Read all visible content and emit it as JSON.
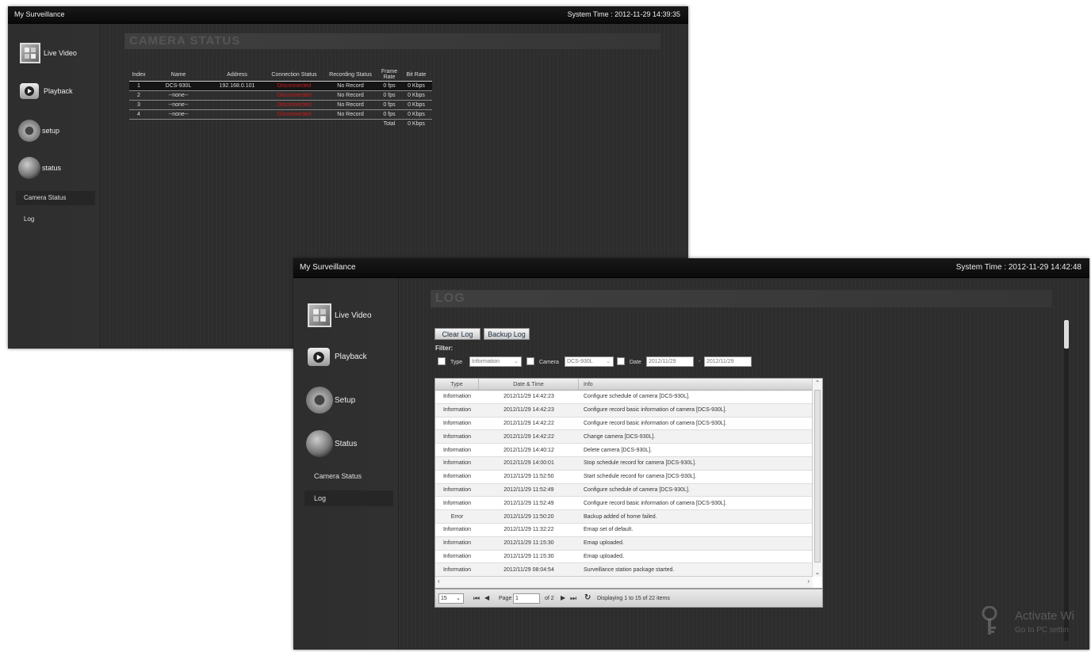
{
  "status_window": {
    "app_title": "My Surveillance",
    "system_time": "System Time : 2012-11-29 14:39:35",
    "nav": {
      "live_video": "Live Video",
      "playback": "Playback",
      "setup": "setup",
      "status": "status",
      "camera_status": "Camera Status",
      "log": "Log"
    },
    "section_title": "CAMERA STATUS",
    "table": {
      "headers": [
        "Index",
        "Name",
        "Address",
        "Connection Status",
        "Recording Status",
        "Frame Rate",
        "Bit Rate"
      ],
      "rows": [
        [
          "1",
          "DCS-930L",
          "192.168.0.101",
          "Disconnected",
          "No Record",
          "0 fps",
          "0 Kbps"
        ],
        [
          "2",
          "--none--",
          "",
          "Disconnected",
          "No Record",
          "0 fps",
          "0 Kbps"
        ],
        [
          "3",
          "--none--",
          "",
          "Disconnected",
          "No Record",
          "0 fps",
          "0 Kbps"
        ],
        [
          "4",
          "--none--",
          "",
          "Disconnected",
          "No Record",
          "0 fps",
          "0 Kbps"
        ]
      ],
      "total_label": "Total",
      "total_value": "0 Kbps"
    }
  },
  "log_window": {
    "app_title": "My Surveillance",
    "system_time": "System Time : 2012-11-29 14:42:48",
    "nav": {
      "live_video": "Live Video",
      "playback": "Playback",
      "setup": "Setup",
      "status": "Status",
      "camera_status": "Camera Status",
      "log": "Log"
    },
    "section_title": "LOG",
    "clear_log": "Clear Log",
    "backup_log": "Backup Log",
    "filter_label": "Filter:",
    "type_label": "Type",
    "type_value": "Information",
    "camera_label": "Camera",
    "camera_value": "DCS-930L",
    "date_label": "Date",
    "date_from": "2012/11/29",
    "date_sep": "-",
    "date_to": "2012/11/29",
    "columns": [
      "Type",
      "Date & Time",
      "Info"
    ],
    "rows": [
      [
        "Information",
        "2012/11/29 14:42:23",
        "Configure schedule of camera [DCS-930L]."
      ],
      [
        "Information",
        "2012/11/29 14:42:23",
        "Configure record basic information of camera [DCS-930L]."
      ],
      [
        "Information",
        "2012/11/29 14:42:22",
        "Configure record basic information of camera [DCS-930L]."
      ],
      [
        "Information",
        "2012/11/29 14:42:22",
        "Change camera [DCS-930L]."
      ],
      [
        "Information",
        "2012/11/29 14:40:12",
        "Delete camera [DCS-930L]."
      ],
      [
        "Information",
        "2012/11/29 14:00:01",
        "Stop schedule record for camera [DCS-930L]."
      ],
      [
        "Information",
        "2012/11/29 11:52:50",
        "Start schedule record for camera [DCS-930L]."
      ],
      [
        "Information",
        "2012/11/29 11:52:49",
        "Configure schedule of camera [DCS-930L]."
      ],
      [
        "Information",
        "2012/11/29 11:52:49",
        "Configure record basic information of camera [DCS-930L]."
      ],
      [
        "Error",
        "2012/11/29 11:50:20",
        "Backup added of home failed."
      ],
      [
        "Information",
        "2012/11/29 11:32:22",
        "Emap set of default."
      ],
      [
        "Information",
        "2012/11/29 11:15:30",
        "Emap uploaded."
      ],
      [
        "Information",
        "2012/11/29 11:15:30",
        "Emap uploaded."
      ],
      [
        "Information",
        "2012/11/29 08:04:54",
        "Surveillance station package started."
      ]
    ],
    "pager": {
      "page_size": "15",
      "page_label": "Page",
      "page_value": "1",
      "of_label": "of 2",
      "display_text": "Displaying 1 to 15 of 22 items"
    }
  },
  "watermark": {
    "line1": "Activate Wi",
    "line2": "Go to PC settin"
  }
}
